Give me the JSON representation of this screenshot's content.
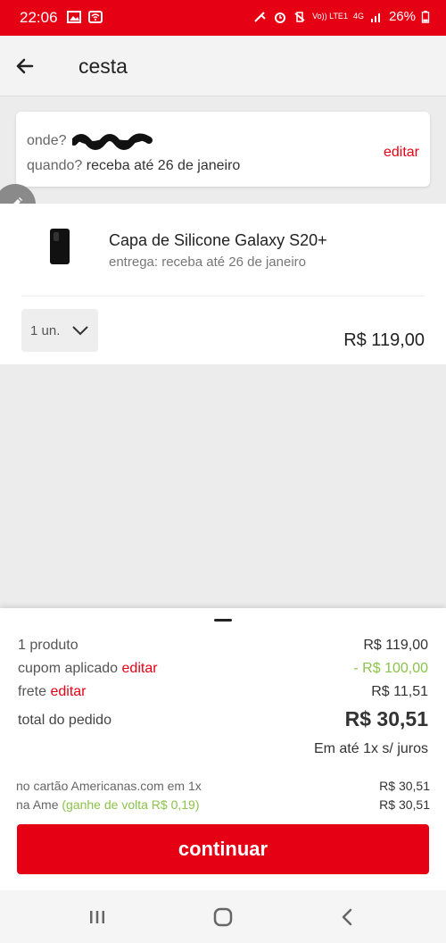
{
  "status_bar": {
    "time": "22:06",
    "battery": "26%",
    "network_label": "4G",
    "volte_label": "Vo)) LTE1",
    "icons": [
      "image-icon",
      "wifi-icon",
      "mute-icon",
      "alarm-icon",
      "vibrate-icon",
      "signal-icon",
      "battery-icon"
    ],
    "color": "#e60014"
  },
  "header": {
    "title": "cesta"
  },
  "delivery": {
    "where_label": "onde?",
    "when_label": "quando?",
    "when_value": "receba até 26 de janeiro",
    "edit_label": "editar"
  },
  "product": {
    "name": "Capa de Silicone Galaxy S20+",
    "delivery_text": "entrega: receba até 26 de janeiro",
    "quantity": "1 un.",
    "price": "R$ 119,00"
  },
  "summary": {
    "products_label": "1 produto",
    "products_value": "R$ 119,00",
    "coupon_label": "cupom aplicado",
    "coupon_edit": "editar",
    "coupon_value": "- R$ 100,00",
    "shipping_label": "frete",
    "shipping_edit": "editar",
    "shipping_value": "R$ 11,51",
    "total_label": "total do pedido",
    "total_value": "R$ 30,51",
    "installments": "Em até 1x s/ juros",
    "card_label": "no cartão Americanas.com em 1x",
    "card_value": "R$ 30,51",
    "ame_label": "na Ame",
    "ame_cashback": "(ganhe de volta R$ 0,19)",
    "ame_value": "R$ 30,51",
    "continue_label": "continuar"
  },
  "colors": {
    "accent": "#e60014",
    "discount": "#8bc34a"
  }
}
